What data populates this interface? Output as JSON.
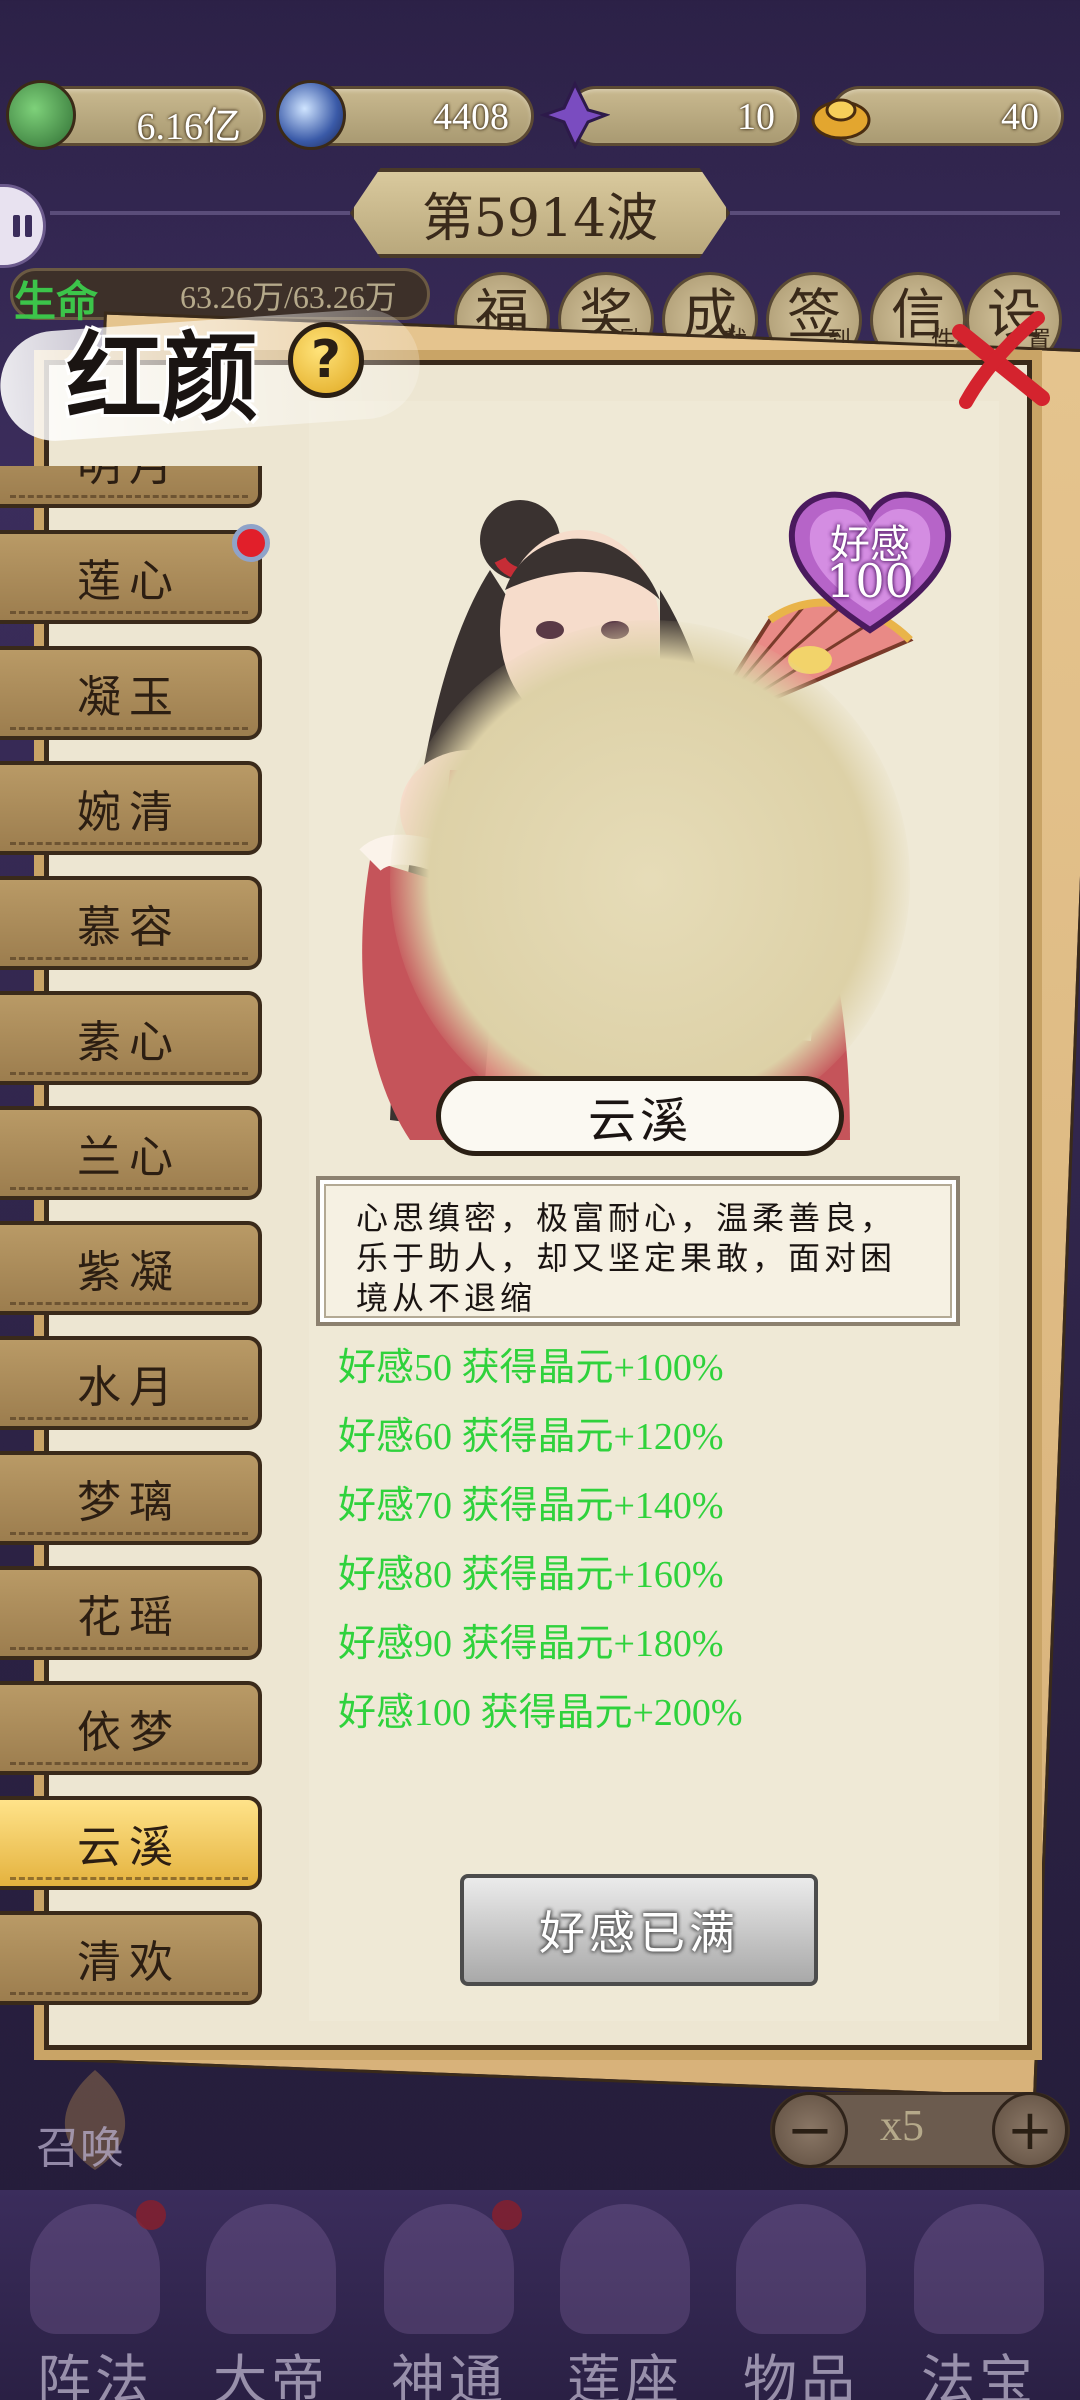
{
  "resources": [
    {
      "icon": "jade-leaf-icon",
      "value": "6.16亿"
    },
    {
      "icon": "blue-orb-icon",
      "value": "4408"
    },
    {
      "icon": "purple-crystal-icon",
      "value": "10"
    },
    {
      "icon": "gold-ingot-icon",
      "value": "40"
    }
  ],
  "wave": {
    "label": "第5914波"
  },
  "life": {
    "label": "生命",
    "value": "63.26万/63.26万"
  },
  "top_menu": [
    {
      "big": "福",
      "small": "利"
    },
    {
      "big": "奖",
      "small": "励"
    },
    {
      "big": "成",
      "small": "就"
    },
    {
      "big": "签",
      "small": "到"
    },
    {
      "big": "信",
      "small": "件"
    },
    {
      "big": "设",
      "small": "置"
    }
  ],
  "panel": {
    "title": "红颜",
    "help": "?"
  },
  "characters": [
    {
      "name": "明月",
      "active": false
    },
    {
      "name": "莲心",
      "active": false
    },
    {
      "name": "凝玉",
      "active": false
    },
    {
      "name": "婉清",
      "active": false
    },
    {
      "name": "慕容",
      "active": false
    },
    {
      "name": "素心",
      "active": false
    },
    {
      "name": "兰心",
      "active": false
    },
    {
      "name": "紫凝",
      "active": false
    },
    {
      "name": "水月",
      "active": false
    },
    {
      "name": "梦璃",
      "active": false
    },
    {
      "name": "花瑶",
      "active": false
    },
    {
      "name": "依梦",
      "active": false
    },
    {
      "name": "云溪",
      "active": true
    },
    {
      "name": "清欢",
      "active": false
    }
  ],
  "selected": {
    "name": "云溪",
    "affection_label": "好感",
    "affection_value": "100",
    "description": "心思缜密，极富耐心，温柔善良，乐于助人，却又坚定果敢，面对困境从不退缩",
    "bonuses": [
      "好感50 获得晶元+100%",
      "好感60 获得晶元+120%",
      "好感70 获得晶元+140%",
      "好感80 获得晶元+160%",
      "好感90 获得晶元+180%",
      "好感100 获得晶元+200%"
    ],
    "button": "好感已满"
  },
  "summon": {
    "label": "召唤"
  },
  "multiplier": {
    "minus": "−",
    "value": "x5",
    "plus": "+"
  },
  "bottom_nav": [
    {
      "label": "阵法"
    },
    {
      "label": "大帝"
    },
    {
      "label": "神通"
    },
    {
      "label": "莲座"
    },
    {
      "label": "物品"
    },
    {
      "label": "法宝"
    }
  ],
  "colors": {
    "bonus": "#2fd23c",
    "panel_bg": "#ede6d2",
    "active_tab": "#e4b23e",
    "background": "#2c2147"
  }
}
